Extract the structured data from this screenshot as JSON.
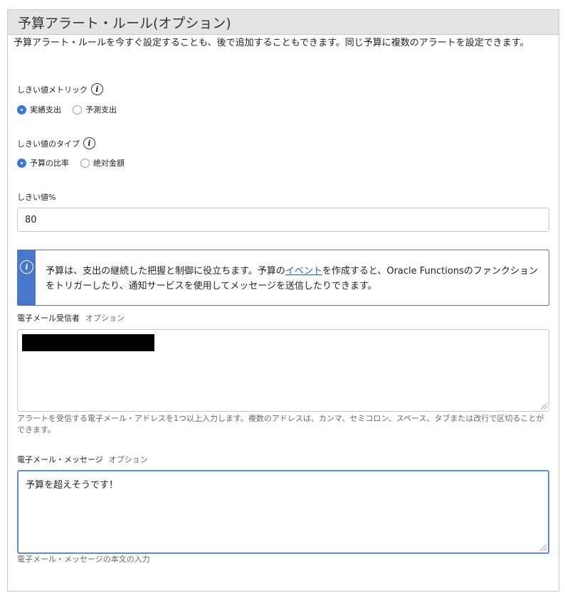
{
  "panel": {
    "title": "予算アラート・ルール(オプション)",
    "intro": "予算アラート・ルールを今すぐ設定することも、後で追加することもできます。同じ予算に複数のアラートを設定できます。"
  },
  "threshold_metric": {
    "label": "しきい値メトリック",
    "options": [
      {
        "label": "実績支出",
        "selected": true
      },
      {
        "label": "予測支出",
        "selected": false
      }
    ]
  },
  "threshold_type": {
    "label": "しきい値のタイプ",
    "options": [
      {
        "label": "予算の比率",
        "selected": true
      },
      {
        "label": "絶対金額",
        "selected": false
      }
    ]
  },
  "threshold_percent": {
    "label": "しきい値%",
    "value": "80"
  },
  "info": {
    "text_before": "予算は、支出の継続した把握と制御に役立ちます。予算の",
    "link": "イベント",
    "text_after": "を作成すると、Oracle Functionsのファンクションをトリガーしたり、通知サービスを使用してメッセージを送信したりできます。"
  },
  "email_recipients": {
    "label": "電子メール受信者",
    "optional": "オプション",
    "help": "アラートを受信する電子メール・アドレスを1つ以上入力します。複数のアドレスは、カンマ、セミコロン、スペース、タブまたは改行で区切ることができます。"
  },
  "email_message": {
    "label": "電子メール・メッセージ",
    "optional": "オプション",
    "value": "予算を超えそうです！",
    "help": "電子メール・メッセージの本文の入力"
  }
}
